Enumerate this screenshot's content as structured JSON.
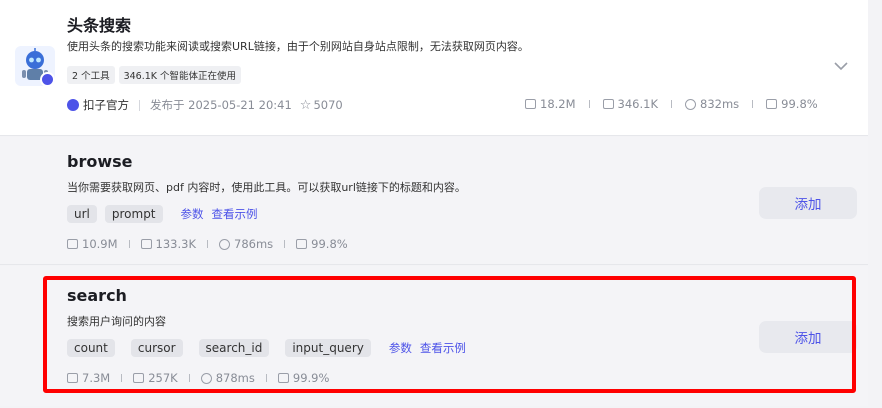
{
  "plugin": {
    "title": "头条搜索",
    "description": "使用头条的搜索功能来阅读或搜索URL链接，由于个别网站自身站点限制，无法获取网页内容。",
    "tags": [
      "2 个工具",
      "346.1K 个智能体正在使用"
    ],
    "author": "扣子官方",
    "published": "发布于 2025-05-21 20:41",
    "stars": "5070",
    "stats": {
      "runs": "18.2M",
      "bots": "346.1K",
      "latency": "832ms",
      "success": "99.8%"
    }
  },
  "tools": [
    {
      "title": "browse",
      "description": "当你需要获取网页、pdf 内容时，使用此工具。可以获取url链接下的标题和内容。",
      "params": [
        "url",
        "prompt"
      ],
      "params_link": "参数",
      "example_link": "查看示例",
      "add_label": "添加",
      "stats": {
        "runs": "10.9M",
        "bots": "133.3K",
        "latency": "786ms",
        "success": "99.8%"
      }
    },
    {
      "title": "search",
      "description": "搜索用户询问的内容",
      "params": [
        "count",
        "cursor",
        "search_id",
        "input_query"
      ],
      "params_link": "参数",
      "example_link": "查看示例",
      "add_label": "添加",
      "stats": {
        "runs": "7.3M",
        "bots": "257K",
        "latency": "878ms",
        "success": "99.9%"
      }
    }
  ],
  "colors": {
    "accent": "#4d53e8",
    "highlight": "#ff0000"
  }
}
